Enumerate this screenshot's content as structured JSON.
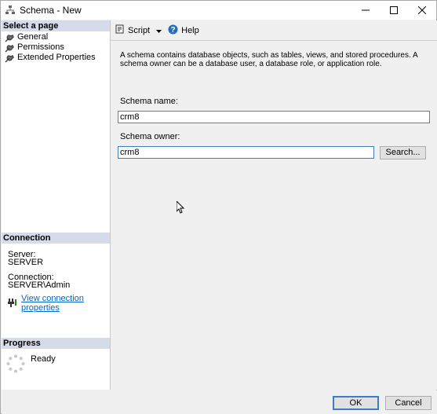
{
  "window": {
    "title": "Schema - New"
  },
  "left_panel": {
    "select_page_header": "Select a page",
    "pages": [
      {
        "label": "General"
      },
      {
        "label": "Permissions"
      },
      {
        "label": "Extended Properties"
      }
    ],
    "connection_header": "Connection",
    "server_label": "Server:",
    "server_value": "SERVER",
    "connection_label": "Connection:",
    "connection_value": "SERVER\\Admin",
    "view_connection_link": "View connection properties",
    "progress_header": "Progress",
    "progress_status": "Ready"
  },
  "toolbar": {
    "script_label": "Script",
    "help_label": "Help"
  },
  "main": {
    "description": "A schema contains database objects, such as tables, views, and stored procedures. A schema owner can be a database user, a database role, or application role.",
    "schema_name_label": "Schema name:",
    "schema_name_value": "crm8",
    "schema_owner_label": "Schema owner:",
    "schema_owner_value": "crm8",
    "search_button": "Search..."
  },
  "footer": {
    "ok_label": "OK",
    "cancel_label": "Cancel"
  },
  "colors": {
    "section_header_bg": "#d6dbe9",
    "link": "#0066cc",
    "focus_border": "#3e7dc4"
  }
}
